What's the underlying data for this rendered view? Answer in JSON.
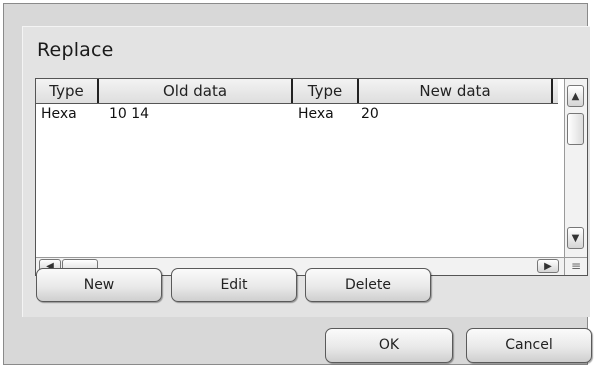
{
  "dialog": {
    "group_title": "Replace",
    "table": {
      "headers": [
        "Type",
        "Old data",
        "Type",
        "New data"
      ],
      "rows": [
        {
          "type_old": "Hexa",
          "old_data": "10 14",
          "type_new": "Hexa",
          "new_data": "20"
        }
      ]
    },
    "scrollbar_icons": {
      "up": "▲",
      "down": "▼",
      "left": "◀",
      "right": "▶",
      "grip": "≡"
    },
    "buttons": {
      "new": "New",
      "edit": "Edit",
      "delete": "Delete",
      "ok": "OK",
      "cancel": "Cancel"
    }
  }
}
